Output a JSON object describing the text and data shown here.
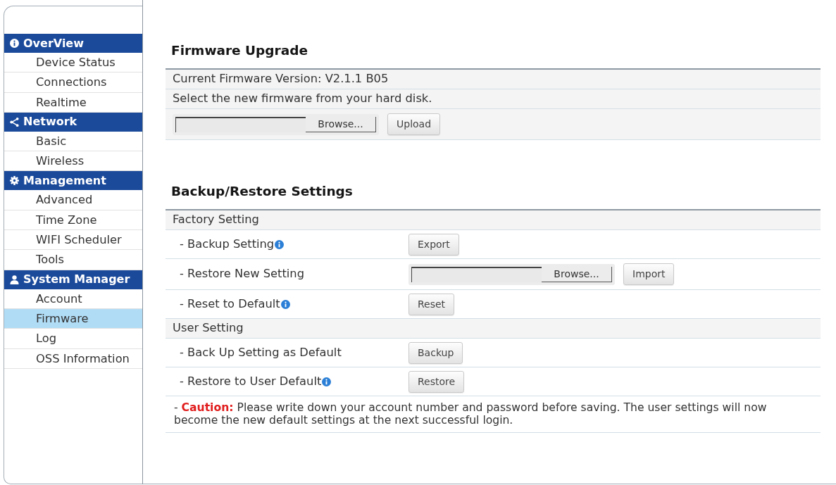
{
  "sidebar": {
    "groups": [
      {
        "title": "OverView",
        "items": [
          {
            "label": "Device Status",
            "selected": false
          },
          {
            "label": "Connections",
            "selected": false
          },
          {
            "label": "Realtime",
            "selected": false
          }
        ]
      },
      {
        "title": "Network",
        "items": [
          {
            "label": "Basic",
            "selected": false
          },
          {
            "label": "Wireless",
            "selected": false
          }
        ]
      },
      {
        "title": "Management",
        "items": [
          {
            "label": "Advanced",
            "selected": false
          },
          {
            "label": "Time Zone",
            "selected": false
          },
          {
            "label": "WIFI Scheduler",
            "selected": false
          },
          {
            "label": "Tools",
            "selected": false
          }
        ]
      },
      {
        "title": "System Manager",
        "items": [
          {
            "label": "Account",
            "selected": false
          },
          {
            "label": "Firmware",
            "selected": true
          },
          {
            "label": "Log",
            "selected": false
          },
          {
            "label": "OSS Information",
            "selected": false
          }
        ]
      }
    ]
  },
  "firmware_upgrade": {
    "title": "Firmware Upgrade",
    "rows": [
      {
        "kind": "text",
        "text": "Current Firmware Version: V2.1.1 B05"
      },
      {
        "kind": "text",
        "text": "Select the new firmware from your hard disk."
      },
      {
        "kind": "file",
        "browse": "Browse...",
        "button": "Upload"
      }
    ]
  },
  "backup_restore": {
    "title": "Backup/Restore Settings",
    "rows": [
      {
        "kind": "section",
        "text": "Factory Setting"
      },
      {
        "kind": "action",
        "label": "- Backup Setting",
        "info_icon": true,
        "button": "Export"
      },
      {
        "kind": "file",
        "label": "- Restore New Setting",
        "info_icon": false,
        "browse": "Browse...",
        "button": "Import"
      },
      {
        "kind": "action",
        "label": "- Reset to Default",
        "info_icon": true,
        "button": "Reset"
      },
      {
        "kind": "section",
        "text": "User Setting"
      },
      {
        "kind": "action",
        "label": "- Back Up Setting as Default",
        "info_icon": false,
        "button": "Backup"
      },
      {
        "kind": "action",
        "label": "- Restore to User Default",
        "info_icon": true,
        "button": "Restore"
      },
      {
        "kind": "note",
        "text": "- **Caution:** Please write down your account number and password before saving. The user settings will now become the new default settings at the next successful login."
      }
    ]
  }
}
